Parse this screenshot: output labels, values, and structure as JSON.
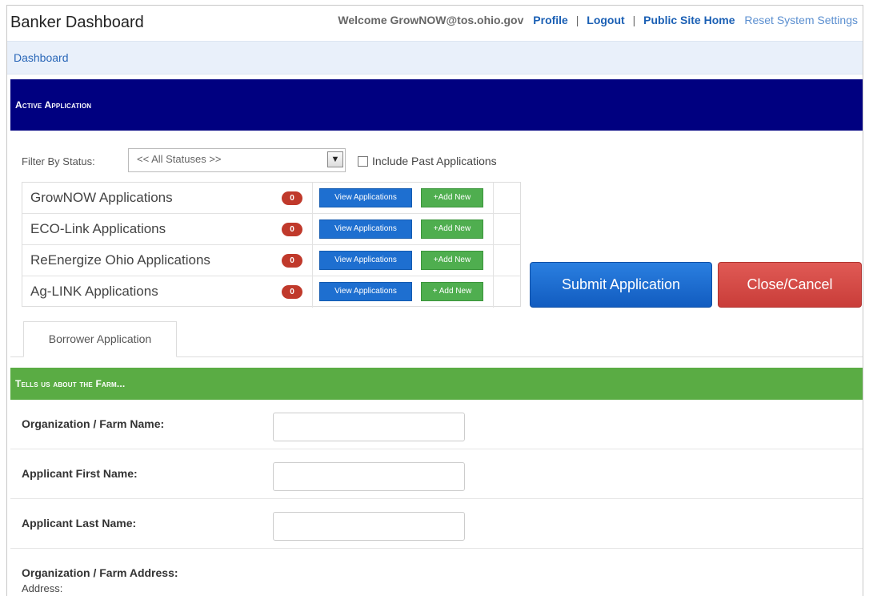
{
  "header": {
    "title": "Banker Dashboard",
    "welcome": "Welcome GrowNOW@tos.ohio.gov",
    "links": {
      "profile": "Profile",
      "logout": "Logout",
      "public_site": "Public Site Home",
      "reset": "Reset System Settings"
    },
    "separator": "|"
  },
  "breadcrumb": {
    "dashboard": "Dashboard"
  },
  "active_section": {
    "title": "Active Application"
  },
  "filter": {
    "label": "Filter By Status:",
    "selected": "<< All Statuses >>",
    "include_past_label": "Include Past Applications",
    "include_past_checked": false
  },
  "applications": [
    {
      "name": "GrowNOW Applications",
      "count": "0",
      "view_label": "View Applications",
      "add_label": "+Add New"
    },
    {
      "name": "ECO-Link Applications",
      "count": "0",
      "view_label": "View Applications",
      "add_label": "+Add New"
    },
    {
      "name": "ReEnergize Ohio Applications",
      "count": "0",
      "view_label": "View Applications",
      "add_label": "+Add New"
    },
    {
      "name": "Ag-LINK Applications",
      "count": "0",
      "view_label": "View Applications",
      "add_label": "+ Add New"
    }
  ],
  "actions": {
    "submit": "Submit Application",
    "cancel": "Close/Cancel"
  },
  "tabs": {
    "borrower": "Borrower Application"
  },
  "farm_section": {
    "title": "Tells us about the Farm..."
  },
  "form": {
    "org_name_label": "Organization / Farm Name:",
    "org_name_value": "",
    "first_name_label": "Applicant First Name:",
    "first_name_value": "",
    "last_name_label": "Applicant Last Name:",
    "last_name_value": "",
    "address_title": "Organization / Farm Address:",
    "address_sub": "Address:"
  },
  "colors": {
    "navy_bar": "#000080",
    "green_bar": "#5aac44",
    "primary_button": "#1e6fd0",
    "danger_button": "#c93d39",
    "count_badge": "#c0392b"
  }
}
